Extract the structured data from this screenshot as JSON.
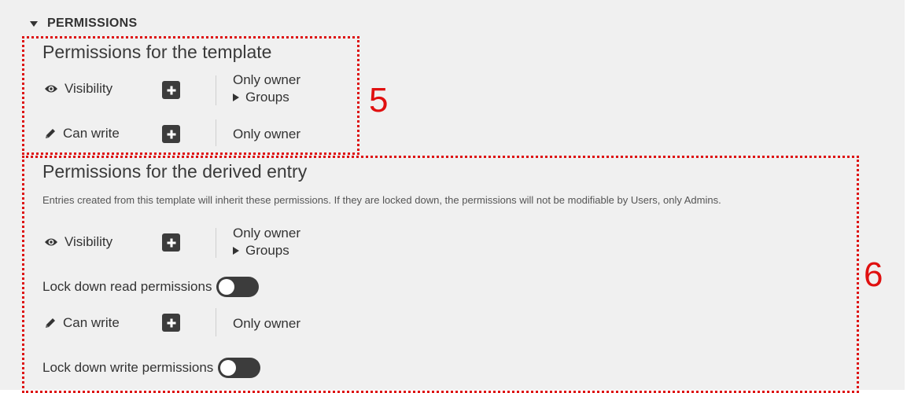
{
  "section": {
    "title": "PERMISSIONS"
  },
  "callouts": {
    "template_label": "5",
    "derived_label": "6"
  },
  "template_permissions": {
    "title": "Permissions for the template",
    "visibility": {
      "label": "Visibility",
      "owner": "Only owner",
      "groups": "Groups"
    },
    "can_write": {
      "label": "Can write",
      "owner": "Only owner"
    }
  },
  "derived_permissions": {
    "title": "Permissions for the derived entry",
    "description": "Entries created from this template will inherit these permissions. If they are locked down, the permissions will not be modifiable by Users, only Admins.",
    "visibility": {
      "label": "Visibility",
      "owner": "Only owner",
      "groups": "Groups"
    },
    "lock_read": {
      "label": "Lock down read permissions",
      "state": "off"
    },
    "can_write": {
      "label": "Can write",
      "owner": "Only owner"
    },
    "lock_write": {
      "label": "Lock down write permissions",
      "state": "off"
    }
  },
  "icons": [
    "eye-icon",
    "pencil-icon",
    "plus-icon",
    "caret-down-icon",
    "caret-right-icon"
  ],
  "colors": {
    "annotation": "#e01010",
    "button_dark": "#3c3c3c",
    "panel_bg": "#f0f0f0"
  }
}
